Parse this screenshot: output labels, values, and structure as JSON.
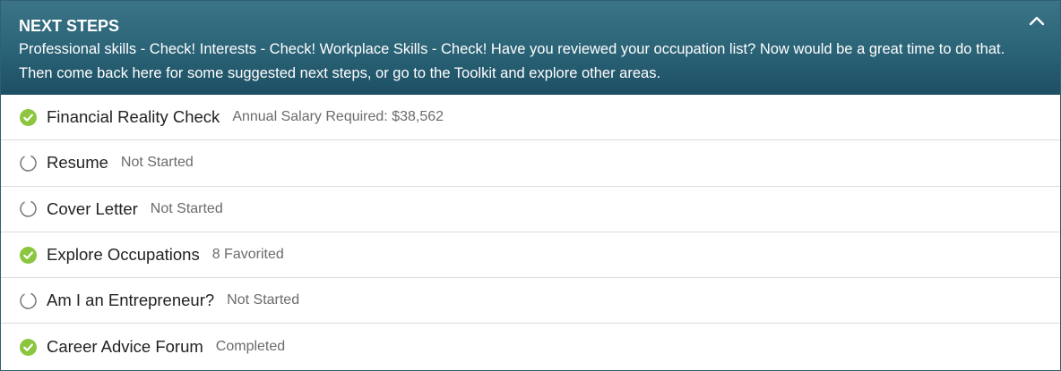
{
  "panel": {
    "title": "NEXT STEPS",
    "description": "Professional skills - Check! Interests - Check! Workplace Skills - Check! Have you reviewed your occupation list? Now would be a great time to do that. Then come back here for some suggested next steps, or go to the Toolkit and explore other areas.",
    "collapse_icon": "chevron-up-icon"
  },
  "colors": {
    "header_bg": "#2a6276",
    "check_green": "#8cc63f",
    "ring_gray": "#777777"
  },
  "steps": [
    {
      "label": "Financial Reality Check",
      "status": "Annual Salary Required: $38,562",
      "state": "complete",
      "icon": "check-circle-icon"
    },
    {
      "label": "Resume",
      "status": "Not Started",
      "state": "not-started",
      "icon": "empty-circle-icon"
    },
    {
      "label": "Cover Letter",
      "status": "Not Started",
      "state": "not-started",
      "icon": "empty-circle-icon"
    },
    {
      "label": "Explore Occupations",
      "status": "8 Favorited",
      "state": "complete",
      "icon": "check-circle-icon"
    },
    {
      "label": "Am I an Entrepreneur?",
      "status": "Not Started",
      "state": "not-started",
      "icon": "empty-circle-icon"
    },
    {
      "label": "Career Advice Forum",
      "status": "Completed",
      "state": "complete",
      "icon": "check-circle-icon"
    }
  ]
}
